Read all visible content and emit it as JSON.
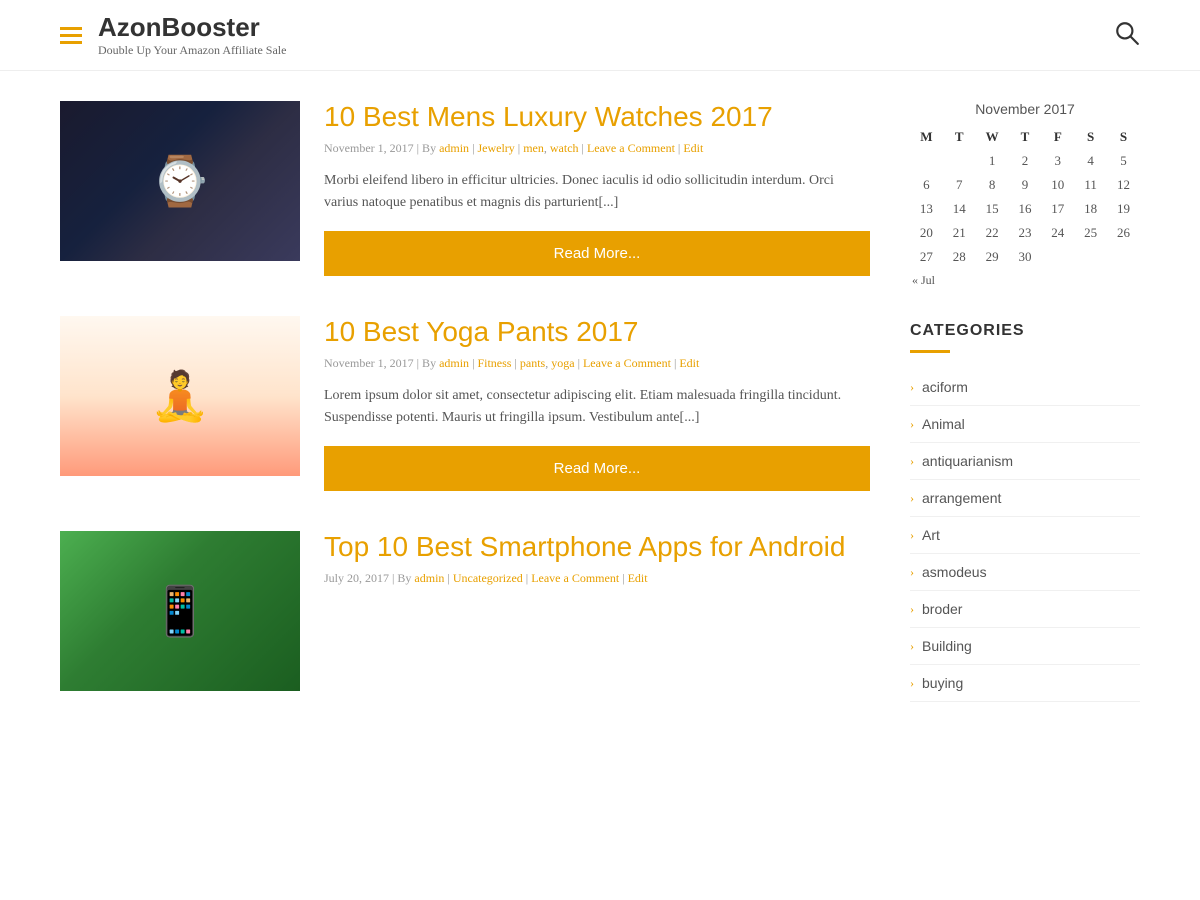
{
  "header": {
    "site_title": "AzonBooster",
    "site_tagline": "Double Up Your Amazon Affiliate Sale"
  },
  "posts": [
    {
      "id": "post-1",
      "title": "10 Best Mens Luxury Watches 2017",
      "date": "November 1, 2017",
      "author": "admin",
      "categories": [
        "Jewelry"
      ],
      "tags": [
        "men",
        "watch"
      ],
      "comment_link": "Leave a Comment",
      "edit_label": "Edit",
      "excerpt": "Morbi eleifend libero in efficitur ultricies. Donec iaculis id odio sollicitudin interdum. Orci varius natoque penatibus et magnis dis parturient[...]",
      "read_more": "Read More...",
      "image_type": "watches"
    },
    {
      "id": "post-2",
      "title": "10 Best Yoga Pants 2017",
      "date": "November 1, 2017",
      "author": "admin",
      "categories": [
        "Fitness"
      ],
      "tags": [
        "pants",
        "yoga"
      ],
      "comment_link": "Leave a Comment",
      "edit_label": "Edit",
      "excerpt": "Lorem ipsum dolor sit amet, consectetur adipiscing elit. Etiam malesuada fringilla tincidunt. Suspendisse potenti. Mauris ut fringilla ipsum. Vestibulum ante[...]",
      "read_more": "Read More...",
      "image_type": "yoga"
    },
    {
      "id": "post-3",
      "title": "Top 10 Best Smartphone Apps for Android",
      "date": "July 20, 2017",
      "author": "admin",
      "categories": [
        "Uncategorized"
      ],
      "tags": [],
      "comment_link": "Leave a Comment",
      "edit_label": "Edit",
      "excerpt": "",
      "read_more": "",
      "image_type": "apps"
    }
  ],
  "calendar": {
    "title": "November 2017",
    "headers": [
      "M",
      "T",
      "W",
      "T",
      "F",
      "S",
      "S"
    ],
    "weeks": [
      [
        "",
        "",
        "1",
        "2",
        "3",
        "4",
        "5"
      ],
      [
        "6",
        "7",
        "8",
        "9",
        "10",
        "11",
        "12"
      ],
      [
        "13",
        "14",
        "15",
        "16",
        "17",
        "18",
        "19"
      ],
      [
        "20",
        "21",
        "22",
        "23",
        "24",
        "25",
        "26"
      ],
      [
        "27",
        "28",
        "29",
        "30",
        "",
        "",
        ""
      ]
    ],
    "prev_nav": "« Jul"
  },
  "sidebar": {
    "categories_title": "CATEGORIES",
    "categories": [
      {
        "label": "aciform"
      },
      {
        "label": "Animal"
      },
      {
        "label": "antiquarianism"
      },
      {
        "label": "arrangement"
      },
      {
        "label": "Art"
      },
      {
        "label": "asmodeus"
      },
      {
        "label": "broder"
      },
      {
        "label": "Building"
      },
      {
        "label": "buying"
      }
    ]
  }
}
